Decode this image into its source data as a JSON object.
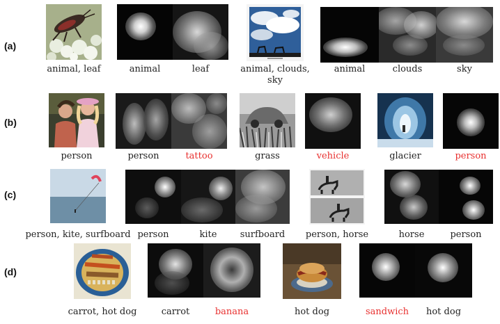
{
  "rows": [
    {
      "label": "(a)",
      "captions": [
        "animal, leaf",
        "animal",
        "leaf",
        "animal, clouds, sky",
        "animal",
        "clouds",
        "sky"
      ]
    },
    {
      "label": "(b)",
      "captions": [
        "person",
        "person",
        "tattoo",
        "grass",
        "vehicle",
        "glacier",
        "person"
      ]
    },
    {
      "label": "(c)",
      "captions": [
        "person, kite, surfboard",
        "person",
        "kite",
        "surfboard",
        "person, horse",
        "horse",
        "person"
      ]
    },
    {
      "label": "(d)",
      "captions": [
        "carrot, hot dog",
        "carrot",
        "banana",
        "hot dog",
        "sandwich",
        "hot dog"
      ]
    }
  ],
  "colors": {
    "correct": "#222222",
    "incorrect": "#e8302f"
  }
}
